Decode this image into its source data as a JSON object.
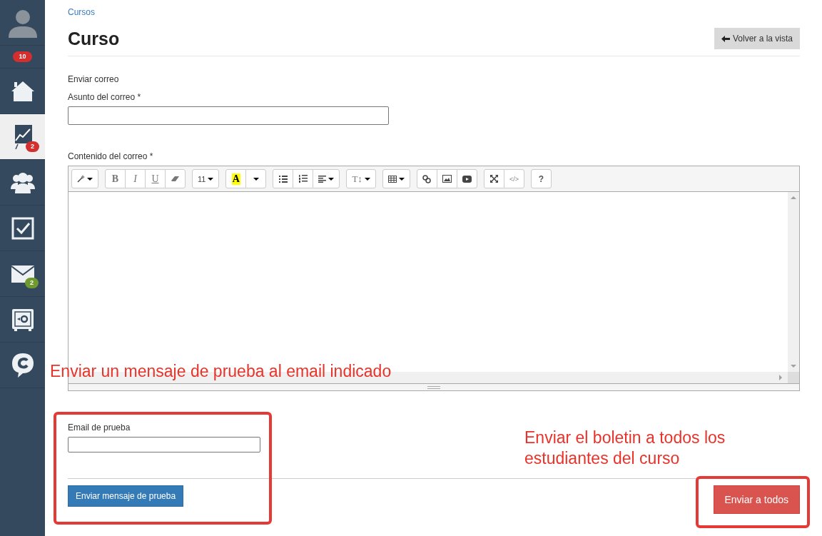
{
  "sidebar": {
    "items": [
      {
        "kind": "avatar",
        "selected": false
      },
      {
        "kind": "counter",
        "selected": false,
        "badge": "10",
        "color": "#d32f2f"
      },
      {
        "kind": "home",
        "selected": false
      },
      {
        "kind": "chart",
        "selected": true,
        "badge": "2",
        "color": "#d32f2f"
      },
      {
        "kind": "users",
        "selected": false
      },
      {
        "kind": "check",
        "selected": false
      },
      {
        "kind": "mail",
        "selected": false,
        "badge": "2",
        "color": "#6e9a2e"
      },
      {
        "kind": "safe",
        "selected": false
      },
      {
        "kind": "chat",
        "selected": false
      }
    ]
  },
  "breadcrumb": "Cursos",
  "title": "Curso",
  "back_button": "Volver a la vista",
  "section_label": "Enviar correo",
  "subject": {
    "label": "Asunto del correo *"
  },
  "content": {
    "label": "Contenido del correo *"
  },
  "toolbar": [
    [
      {
        "kind": "wand"
      }
    ],
    [
      {
        "kind": "bold",
        "label": "B"
      },
      {
        "kind": "italic",
        "label": "I"
      },
      {
        "kind": "underline",
        "label": "U"
      },
      {
        "kind": "eraser"
      }
    ],
    [
      {
        "kind": "size",
        "label": "11"
      }
    ],
    [
      {
        "kind": "highlight",
        "label": "A"
      },
      {
        "kind": "dropdown"
      }
    ],
    [
      {
        "kind": "ul"
      },
      {
        "kind": "ol"
      },
      {
        "kind": "align"
      }
    ],
    [
      {
        "kind": "heading",
        "label": "T↕"
      }
    ],
    [
      {
        "kind": "table"
      }
    ],
    [
      {
        "kind": "link"
      },
      {
        "kind": "image"
      },
      {
        "kind": "video"
      }
    ],
    [
      {
        "kind": "fullscreen"
      },
      {
        "kind": "code",
        "label": "</>"
      }
    ],
    [
      {
        "kind": "help",
        "label": "?"
      }
    ]
  ],
  "test_email": {
    "label": "Email de prueba"
  },
  "test_button": "Enviar mensaje de prueba",
  "send_button": "Enviar a todos",
  "annotations": [
    {
      "text": "Enviar un mensaje de prueba al email indicado"
    },
    {
      "text": "Enviar el boletin a todos los estudiantes del curso"
    }
  ]
}
